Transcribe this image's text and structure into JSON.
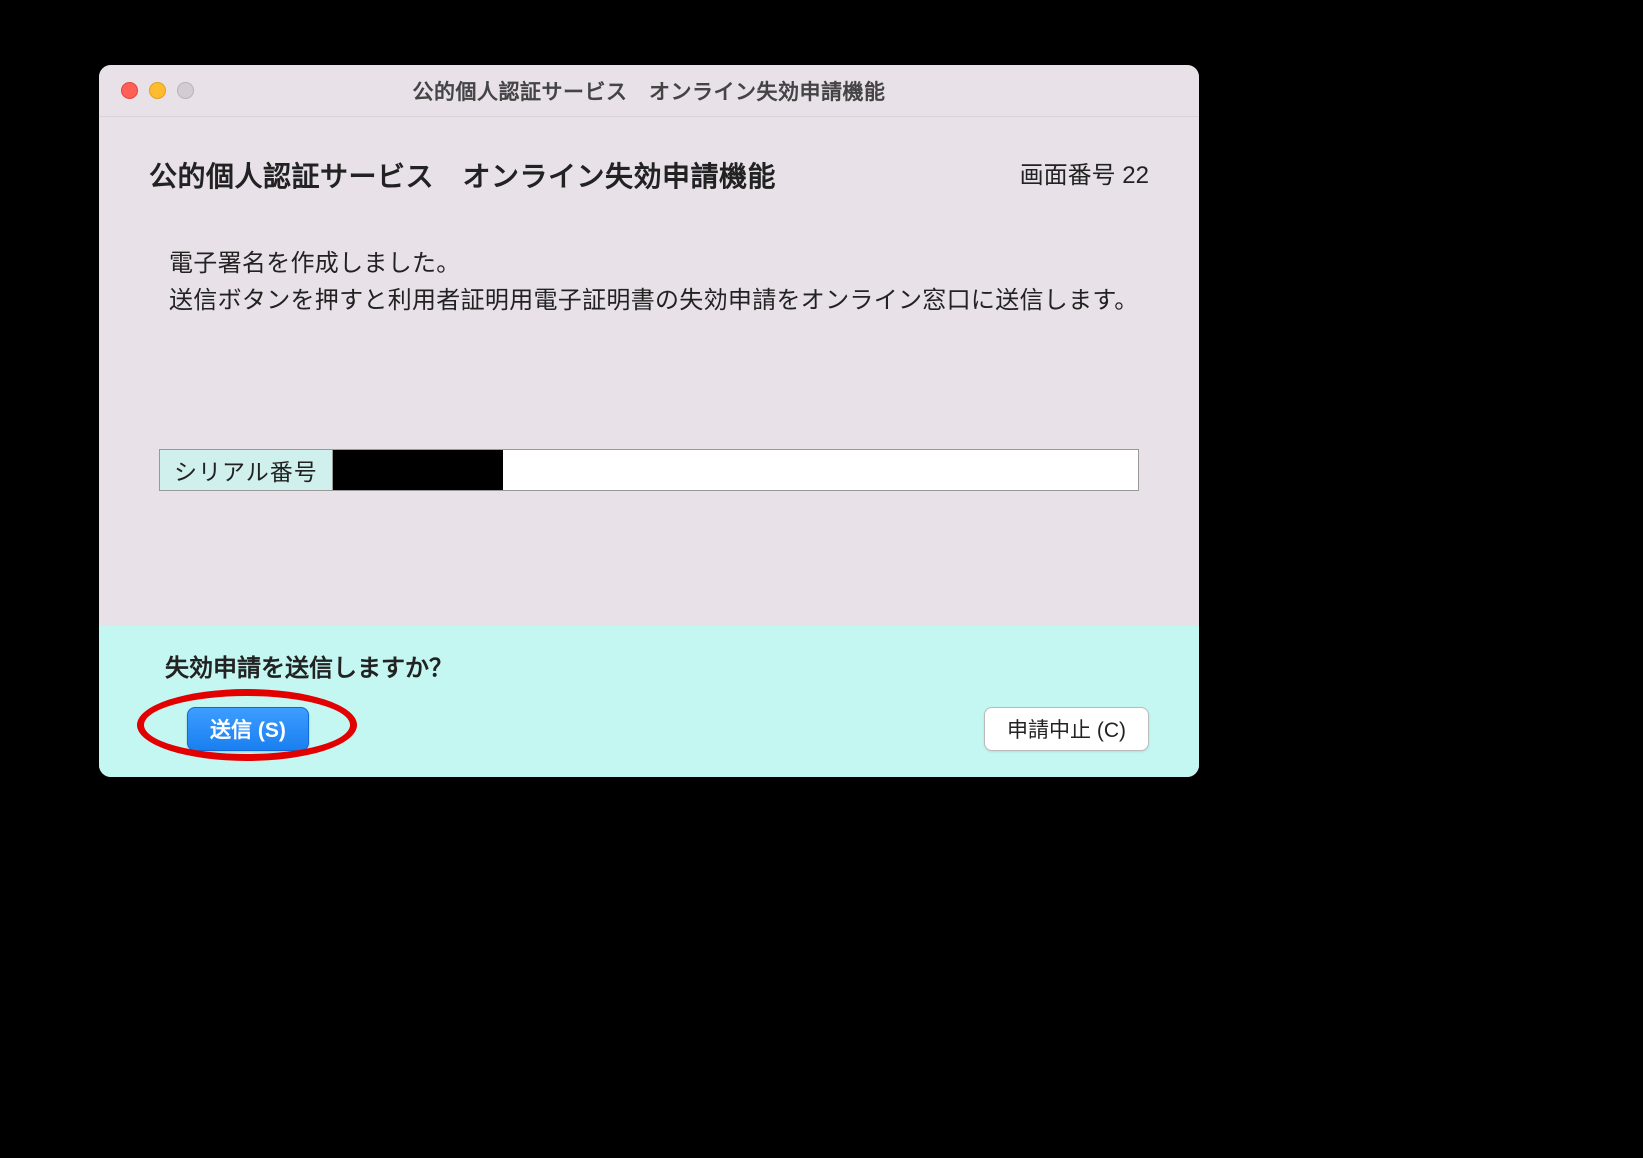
{
  "window": {
    "title": "公的個人認証サービス　オンライン失効申請機能"
  },
  "header": {
    "page_title": "公的個人認証サービス　オンライン失効申請機能",
    "screen_number": "画面番号 22"
  },
  "body": {
    "line1": "電子署名を作成しました。",
    "line2": "送信ボタンを押すと利用者証明用電子証明書の失効申請をオンライン窓口に送信します。"
  },
  "serial": {
    "label": "シリアル番号",
    "value": ""
  },
  "footer": {
    "confirm_text": "失効申請を送信しますか？",
    "send_label": "送信 (S)",
    "cancel_label": "申請中止 (C)"
  }
}
